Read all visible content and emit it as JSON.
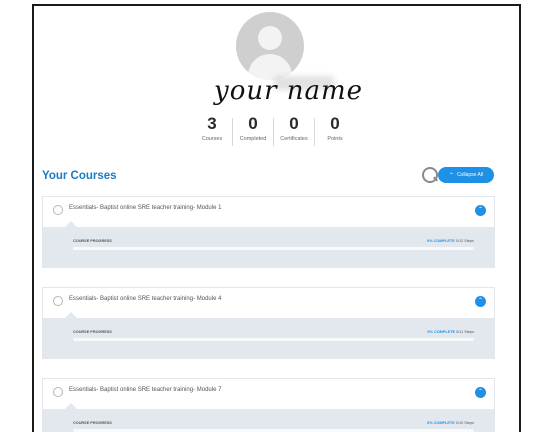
{
  "profile": {
    "handwritten_name": "your name",
    "stats": [
      {
        "value": "3",
        "label": "Courses"
      },
      {
        "value": "0",
        "label": "Completed"
      },
      {
        "value": "0",
        "label": "Certificates"
      },
      {
        "value": "0",
        "label": "Points"
      }
    ]
  },
  "courses_header": {
    "title": "Your Courses",
    "collapse_label": "Collapse All"
  },
  "courses": [
    {
      "title": "Essentials- Baptist online SRE teacher training- Module 1",
      "progress_label": "COURSE PROGRESS",
      "percent_text": "0% COMPLETE",
      "steps_text": "0/12 Steps",
      "progress": 0
    },
    {
      "title": "Essentials- Baptist online SRE teacher training- Module 4",
      "progress_label": "COURSE PROGRESS",
      "percent_text": "0% COMPLETE",
      "steps_text": "0/11 Steps",
      "progress": 0
    },
    {
      "title": "Essentials- Baptist online SRE teacher training- Module 7",
      "progress_label": "COURSE PROGRESS",
      "percent_text": "0% COMPLETE",
      "steps_text": "0/10 Steps",
      "progress": 0
    }
  ],
  "colors": {
    "accent": "#1e90e6",
    "title": "#1b7bc4"
  }
}
